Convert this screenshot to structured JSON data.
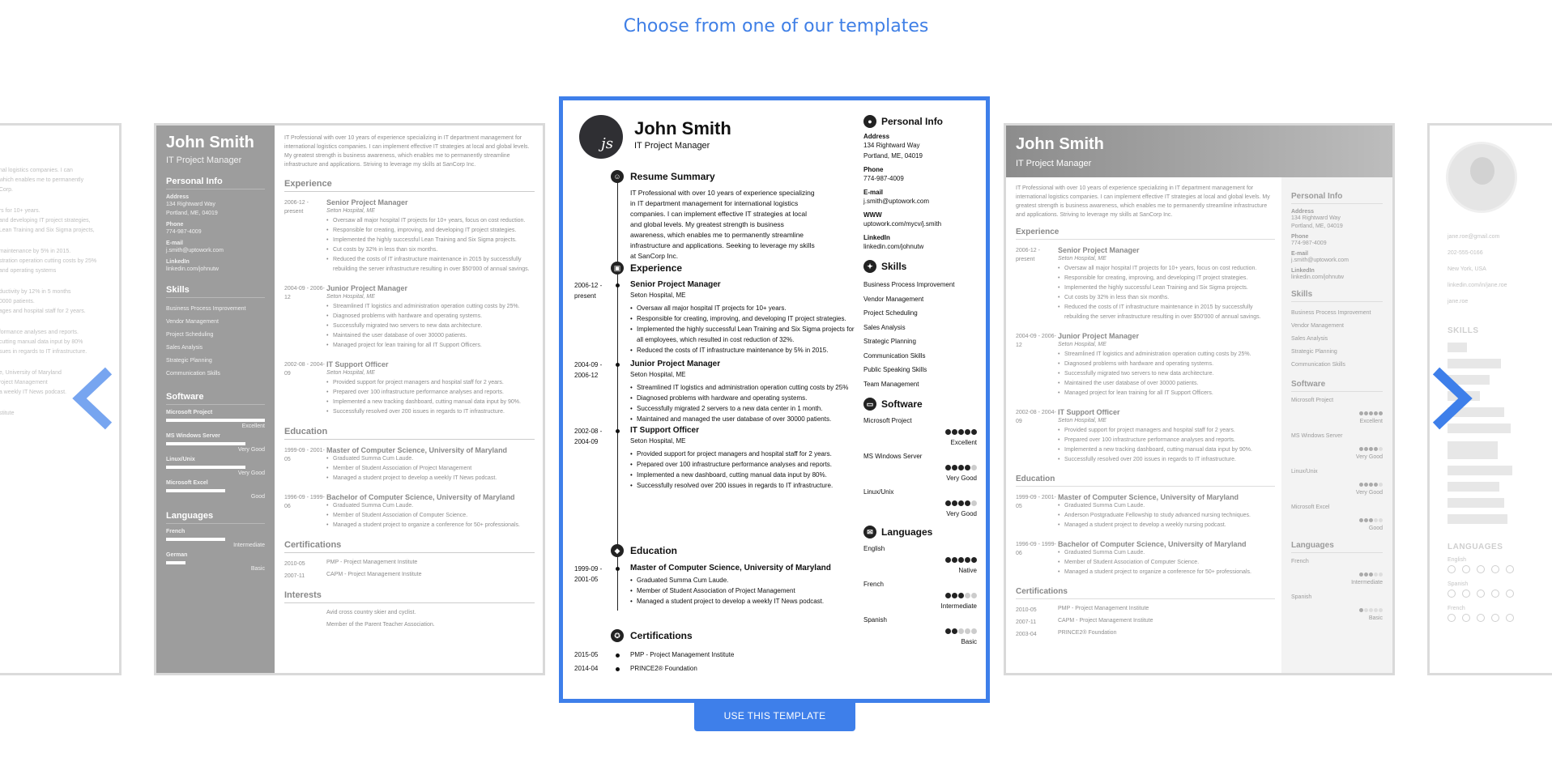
{
  "heading": "Choose from one of our templates",
  "use_button": "USE THIS TEMPLATE",
  "colors": {
    "accent": "#3e7fea",
    "heading": "#3f7fe6"
  },
  "icons": {
    "prev": "chevron-left-icon",
    "next": "chevron-right-icon"
  },
  "featured": {
    "initials": "js",
    "name": "John Smith",
    "title": "IT Project Manager",
    "summary_heading": "Resume Summary",
    "summary": "IT Professional with over 10 years of experience specializing in IT department management for international logistics companies. I can implement effective IT strategies at local and global levels. My greatest strength is business awareness, which enables me to permanently streamline infrastructure and applications. Seeking to leverage my skills at SanCorp Inc.",
    "experience_heading": "Experience",
    "jobs": [
      {
        "dates": "2006-12 - present",
        "title": "Senior Project Manager",
        "company": "Seton Hospital, ME",
        "bullets": [
          "Oversaw all major hospital IT projects for 10+ years.",
          "Responsible for creating, improving, and developing IT project strategies.",
          "Implemented the highly successful Lean Training and Six Sigma projects for all employees, which resulted in cost reduction of 32%.",
          "Reduced the costs of IT infrastructure maintenance by 5% in 2015."
        ]
      },
      {
        "dates": "2004-09 - 2006-12",
        "title": "Junior Project Manager",
        "company": "Seton Hospital, ME",
        "bullets": [
          "Streamlined IT logistics and administration operation cutting costs by 25%",
          "Diagnosed problems with hardware and operating systems.",
          "Successfully migrated 2 servers to a new data center in 1 month.",
          "Maintained and managed the user database of over 30000 patients."
        ]
      },
      {
        "dates": "2002-08 - 2004-09",
        "title": "IT Support Officer",
        "company": "Seton Hospital, ME",
        "bullets": [
          "Provided support for project managers and hospital staff for 2 years.",
          "Prepared over 100 infrastructure performance analyses and reports.",
          "Implemented a new dashboard, cutting manual data input by 80%.",
          "Successfully resolved over 200 issues in regards to IT infrastructure."
        ]
      }
    ],
    "education_heading": "Education",
    "education": {
      "dates": "1999-09 - 2001-05",
      "title": "Master of Computer Science, University of Maryland",
      "bullets": [
        "Graduated Summa Cum Laude.",
        "Member of Student Association of Project Management",
        "Managed a student project to develop a weekly IT News podcast."
      ]
    },
    "certifications_heading": "Certifications",
    "certifications": [
      {
        "date": "2015-05",
        "name": "PMP - Project Management Institute"
      },
      {
        "date": "2014-04",
        "name": "PRINCE2® Foundation"
      }
    ],
    "personal_heading": "Personal Info",
    "address_label": "Address",
    "address_1": "134 Rightward Way",
    "address_2": "Portland, ME, 04019",
    "phone_label": "Phone",
    "phone": "774-987-4009",
    "email_label": "E-mail",
    "email": "j.smith@uptowork.com",
    "www_label": "WWW",
    "www": "uptowork.com/mycv/j.smith",
    "linkedin_label": "LinkedIn",
    "linkedin": "linkedin.com/johnutw",
    "skills_heading": "Skills",
    "skills": [
      "Business Process Improvement",
      "Vendor Management",
      "Project Scheduling",
      "Sales Analysis",
      "Strategic Planning",
      "Communication Skills",
      "Public Speaking Skills",
      "Team Management"
    ],
    "software_heading": "Software",
    "software": [
      {
        "name": "Microsoft Project",
        "rating": 5,
        "level": "Excellent"
      },
      {
        "name": "MS Windows Server",
        "rating": 4,
        "level": "Very Good"
      },
      {
        "name": "Linux/Unix",
        "rating": 4,
        "level": "Very Good"
      }
    ],
    "languages_heading": "Languages",
    "languages": [
      {
        "name": "English",
        "rating": 5,
        "level": "Native"
      },
      {
        "name": "French",
        "rating": 3,
        "level": "Intermediate"
      },
      {
        "name": "Spanish",
        "rating": 2,
        "level": "Basic"
      }
    ]
  },
  "left_card": {
    "name": "John Smith",
    "title": "IT Project Manager",
    "summary": "IT Professional with over 10 years of experience specializing in IT department management for international logistics companies. I can implement effective IT strategies at local and global levels. My greatest strength is business awareness, which enables me to permanently streamline infrastructure and applications. Striving to leverage my skills at SanCorp Inc.",
    "personal_heading": "Personal Info",
    "address_label": "Address",
    "address_1": "134 Rightward Way",
    "address_2": "Portland, ME, 04019",
    "phone_label": "Phone",
    "phone": "774-987-4009",
    "email_label": "E-mail",
    "email": "j.smith@uptowork.com",
    "linkedin_label": "LinkedIn",
    "linkedin": "linkedin.com/johnutw",
    "skills_heading": "Skills",
    "skills": [
      "Business Process Improvement",
      "Vendor Management",
      "Project Scheduling",
      "Sales Analysis",
      "Strategic Planning",
      "Communication Skills"
    ],
    "software_heading": "Software",
    "software": [
      {
        "name": "Microsoft Project",
        "level": "Excellent",
        "fill": 1.0
      },
      {
        "name": "MS Windows Server",
        "level": "Very Good",
        "fill": 0.8
      },
      {
        "name": "Linux/Unix",
        "level": "Very Good",
        "fill": 0.8
      },
      {
        "name": "Microsoft Excel",
        "level": "Good",
        "fill": 0.6
      }
    ],
    "languages_heading": "Languages",
    "languages": [
      {
        "name": "French",
        "level": "Intermediate",
        "fill": 0.6
      },
      {
        "name": "German",
        "level": "Basic",
        "fill": 0.2
      }
    ],
    "experience_heading": "Experience",
    "jobs": [
      {
        "dates": "2006-12 - present",
        "title": "Senior Project Manager",
        "company": "Seton Hospital, ME",
        "bullets": [
          "Oversaw all major hospital IT projects for 10+ years, focus on cost reduction.",
          "Responsible for creating, improving, and developing IT project strategies.",
          "Implemented the highly successful Lean Training and Six Sigma projects.",
          "Cut costs by 32% in less than six months.",
          "Reduced the costs of IT infrastructure maintenance in 2015 by successfully rebuilding the server infrastructure resulting in over $50'000 of annual savings."
        ]
      },
      {
        "dates": "2004-09 - 2006-12",
        "title": "Junior Project Manager",
        "company": "Seton Hospital, ME",
        "bullets": [
          "Streamlined IT logistics and administration operation cutting costs by 25%.",
          "Diagnosed problems with hardware and operating systems.",
          "Successfully migrated two servers to new data architecture.",
          "Maintained the user database of over 30000 patients.",
          "Managed project for lean training for all IT Support Officers."
        ]
      },
      {
        "dates": "2002-08 - 2004-09",
        "title": "IT Support Officer",
        "company": "Seton Hospital, ME",
        "bullets": [
          "Provided support for project managers and hospital staff for 2 years.",
          "Prepared over 100 infrastructure performance analyses and reports.",
          "Implemented a new tracking dashboard, cutting manual data input by 90%.",
          "Successfully resolved over 200 issues in regards to IT infrastructure."
        ]
      }
    ],
    "education_heading": "Education",
    "education": [
      {
        "dates": "1999-09 - 2001-05",
        "title": "Master of Computer Science, University of Maryland",
        "bullets": [
          "Graduated Summa Cum Laude.",
          "Member of Student Association of Project Management",
          "Managed a student project to develop a weekly IT News podcast."
        ]
      },
      {
        "dates": "1996-09 - 1999-06",
        "title": "Bachelor of Computer Science, University of Maryland",
        "bullets": [
          "Graduated Summa Cum Laude.",
          "Member of Student Association of Computer Science.",
          "Managed a student project to organize a conference for 50+ professionals."
        ]
      }
    ],
    "certifications_heading": "Certifications",
    "certifications": [
      {
        "date": "2010-05",
        "name": "PMP - Project Management Institute"
      },
      {
        "date": "2007-11",
        "name": "CAPM - Project Management Institute"
      }
    ],
    "interests_heading": "Interests",
    "interests": [
      "Avid cross country skier and cyclist.",
      "Member of the Parent Teacher Association."
    ]
  },
  "right_card": {
    "name": "John Smith",
    "title": "IT Project Manager",
    "summary": "IT Professional with over 10 years of experience specializing in IT department management for international logistics companies. I can implement effective IT strategies at local and global levels. My greatest strength is business awareness, which enables me to permanently streamline infrastructure and applications. Striving to leverage my skills at SanCorp Inc.",
    "experience_heading": "Experience",
    "jobs": [
      {
        "dates": "2006-12 - present",
        "title": "Senior Project Manager",
        "company": "Seton Hospital, ME",
        "bullets": [
          "Oversaw all major hospital IT projects for 10+ years, focus on cost reduction.",
          "Responsible for creating, improving, and developing IT project strategies.",
          "Implemented the highly successful Lean Training and Six Sigma projects.",
          "Cut costs by 32% in less than six months.",
          "Reduced the costs of IT infrastructure maintenance in 2015 by successfully rebuilding the server infrastructure resulting in over $50'000 of annual savings."
        ]
      },
      {
        "dates": "2004-09 - 2006-12",
        "title": "Junior Project Manager",
        "company": "Seton Hospital, ME",
        "bullets": [
          "Streamlined IT logistics and administration operation cutting costs by 25%.",
          "Diagnosed problems with hardware and operating systems.",
          "Successfully migrated two servers to new data architecture.",
          "Maintained the user database of over 30000 patients.",
          "Managed project for lean training for all IT Support Officers."
        ]
      },
      {
        "dates": "2002-08 - 2004-09",
        "title": "IT Support Officer",
        "company": "Seton Hospital, ME",
        "bullets": [
          "Provided support for project managers and hospital staff for 2 years.",
          "Prepared over 100 infrastructure performance analyses and reports.",
          "Implemented a new tracking dashboard, cutting manual data input by 90%.",
          "Successfully resolved over 200 issues in regards to IT infrastructure."
        ]
      }
    ],
    "education_heading": "Education",
    "education": [
      {
        "dates": "1999-09 - 2001-05",
        "title": "Master of Computer Science, University of Maryland",
        "bullets": [
          "Graduated Summa Cum Laude.",
          "Anderson Postgraduate Fellowship to study advanced nursing techniques.",
          "Managed a student project to develop a weekly nursing podcast."
        ]
      },
      {
        "dates": "1996-09 - 1999-06",
        "title": "Bachelor of Computer Science, University of Maryland",
        "bullets": [
          "Graduated Summa Cum Laude.",
          "Member of Student Association of Computer Science.",
          "Managed a student project to organize a conference for 50+ professionals."
        ]
      }
    ],
    "certifications_heading": "Certifications",
    "certifications": [
      {
        "date": "2010-05",
        "name": "PMP - Project Management Institute"
      },
      {
        "date": "2007-11",
        "name": "CAPM - Project Management Institute"
      },
      {
        "date": "2003-04",
        "name": "PRINCE2® Foundation"
      }
    ],
    "personal_heading": "Personal Info",
    "address_label": "Address",
    "address_1": "134 Rightward Way",
    "address_2": "Portland, ME, 04019",
    "phone_label": "Phone",
    "phone": "774-987-4009",
    "email_label": "E-mail",
    "email": "j.smith@uptowork.com",
    "linkedin_label": "LinkedIn",
    "linkedin": "linkedin.com/johnutw",
    "skills_heading": "Skills",
    "skills": [
      "Business Process Improvement",
      "Vendor Management",
      "Sales Analysis",
      "Strategic Planning",
      "Communication Skills"
    ],
    "software_heading": "Software",
    "software": [
      {
        "name": "Microsoft Project",
        "level": "Excellent",
        "rating": 5
      },
      {
        "name": "MS Windows Server",
        "level": "Very Good",
        "rating": 4
      },
      {
        "name": "Linux/Unix",
        "level": "Very Good",
        "rating": 4
      },
      {
        "name": "Microsoft Excel",
        "level": "Good",
        "rating": 3
      }
    ],
    "languages_heading": "Languages",
    "languages": [
      {
        "name": "French",
        "level": "Intermediate",
        "rating": 3
      },
      {
        "name": "Spanish",
        "level": "Basic",
        "rating": 1
      }
    ]
  },
  "far_left_card": {
    "lines": [
      "...nal logistics companies. I can",
      "...which enables me to permanently",
      "...Corp.",
      "...rs for 10+ years.",
      "...and developing IT project strategies,",
      "...Lean Training and Six Sigma projects,",
      "...maintenance by 5% in 2015.",
      "...stration operation cutting costs by 25%",
      "...and operating systems",
      "...ductivity by 12% in 5 months",
      "...0000 patients.",
      "...ages and hospital staff for 2 years.",
      "...formance analyses and reports.",
      "...cutting manual data input by 80%",
      "...sues in regards to IT infrastructure.",
      "...e, University of Maryland",
      "...roject Management",
      "...a weekly IT News podcast.",
      "...stitute"
    ]
  },
  "far_right_card": {
    "email": "jane.roe@gmail.com",
    "phone": "202-555-0166",
    "location": "New York, USA",
    "linkedin": "linkedin.com/in/jane.roe",
    "web": "jane.roe",
    "skills_heading": "SKILLS",
    "languages_heading": "LANGUAGES",
    "languages": [
      "English",
      "Spanish",
      "French"
    ]
  }
}
